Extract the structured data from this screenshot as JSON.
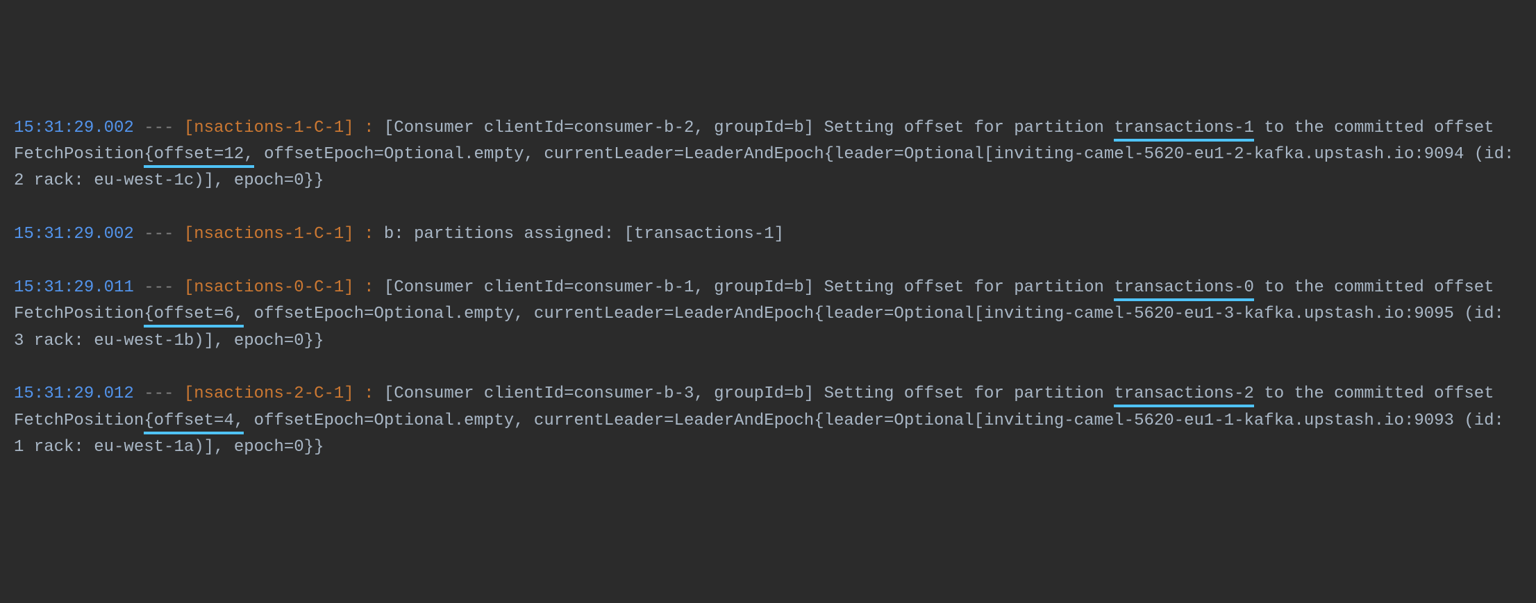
{
  "entries": [
    {
      "timestamp": "15:31:29.002",
      "dashes": " --- ",
      "thread": "[nsactions-1-C-1]",
      "colon": " : ",
      "seg1": "[Consumer clientId=consumer-b-2, groupId=b] Setting offset for partition ",
      "partition": "transactions-1",
      "seg2": " to the committed offset FetchPosition",
      "offset": "{offset=12,",
      "seg3": " offsetEpoch=Optional.empty, currentLeader=LeaderAndEpoch{leader=Optional[inviting-camel-5620-eu1-2-kafka.upstash.io:9094 (id: 2 rack: eu-west-1c)], epoch=0}}"
    },
    {
      "timestamp": "15:31:29.002",
      "dashes": " --- ",
      "thread": "[nsactions-1-C-1]",
      "colon": " : ",
      "seg1": "b: partitions assigned: [transactions-1]",
      "partition": "",
      "seg2": "",
      "offset": "",
      "seg3": ""
    },
    {
      "timestamp": "15:31:29.011",
      "dashes": " --- ",
      "thread": "[nsactions-0-C-1]",
      "colon": " : ",
      "seg1": "[Consumer clientId=consumer-b-1, groupId=b] Setting offset for partition ",
      "partition": "transactions-0",
      "seg2": " to the committed offset FetchPosition",
      "offset": "{offset=6,",
      "seg3": " offsetEpoch=Optional.empty, currentLeader=LeaderAndEpoch{leader=Optional[inviting-camel-5620-eu1-3-kafka.upstash.io:9095 (id: 3 rack: eu-west-1b)], epoch=0}}"
    },
    {
      "timestamp": "15:31:29.012",
      "dashes": " --- ",
      "thread": "[nsactions-2-C-1]",
      "colon": " : ",
      "seg1": "[Consumer clientId=consumer-b-3, groupId=b] Setting offset for partition ",
      "partition": "transactions-2",
      "seg2": " to the committed offset FetchPosition",
      "offset": "{offset=4,",
      "seg3": " offsetEpoch=Optional.empty, currentLeader=LeaderAndEpoch{leader=Optional[inviting-camel-5620-eu1-1-kafka.upstash.io:9093 (id: 1 rack: eu-west-1a)], epoch=0}}"
    }
  ]
}
